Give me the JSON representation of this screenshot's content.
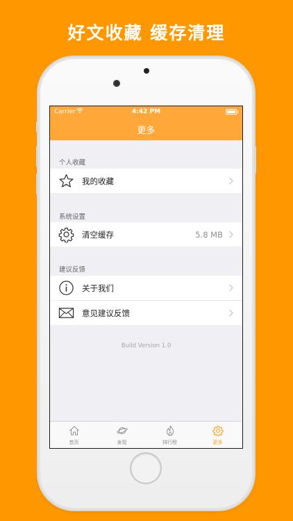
{
  "headline": "好文收藏 缓存清理",
  "status_bar": {
    "carrier": "Carrier",
    "time": "4:42 PM"
  },
  "nav": {
    "title": "更多"
  },
  "sections": [
    {
      "header": "个人收藏",
      "items": [
        {
          "label": "我的收藏",
          "icon": "star-icon"
        }
      ]
    },
    {
      "header": "系统设置",
      "items": [
        {
          "label": "清空缓存",
          "detail": "5.8 MB",
          "icon": "gear-icon"
        }
      ]
    },
    {
      "header": "建议反馈",
      "items": [
        {
          "label": "关于我们",
          "icon": "info-icon"
        },
        {
          "label": "意见建议反馈",
          "icon": "envelope-icon"
        }
      ]
    }
  ],
  "build_version": "Build Version 1.0",
  "tabs": [
    {
      "label": "首页",
      "icon": "home-icon"
    },
    {
      "label": "发现",
      "icon": "planet-icon"
    },
    {
      "label": "排行榜",
      "icon": "flame-icon"
    },
    {
      "label": "更多",
      "icon": "gear-icon",
      "active": true
    }
  ],
  "colors": {
    "background": "#ff9800",
    "navbar": "#ffa738",
    "tab_active": "#ff9f1c"
  }
}
